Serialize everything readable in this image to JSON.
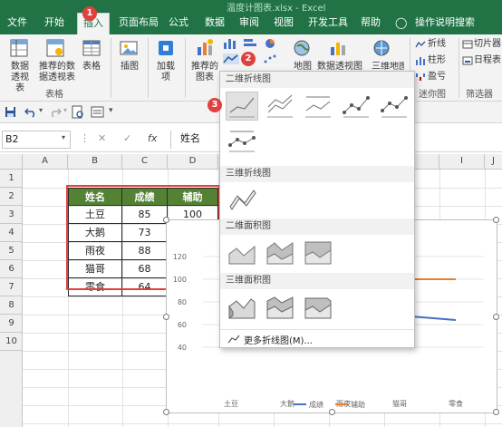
{
  "app": {
    "window_title": "温度计图表.xlsx - Excel",
    "tabs": [
      "文件",
      "开始",
      "插入",
      "页面布局",
      "公式",
      "数据",
      "审阅",
      "视图",
      "开发工具",
      "帮助",
      "操作说明搜索"
    ],
    "active_tab_index": 2
  },
  "ribbon": {
    "pivot_table": "数据透视表",
    "recommended_pivot": "推荐的数据透视表",
    "table": "表格",
    "group_tables": "表格",
    "illustrations": "插图",
    "addins": "加载项",
    "recommended_charts": "推荐的图表",
    "map": "地图",
    "pivot_chart": "数据透视图",
    "three_d_map": "三维地图",
    "sparkline_line": "折线",
    "sparkline_column": "柱形",
    "sparkline_winloss": "盈亏",
    "group_sparklines": "迷你图",
    "slicer": "切片器",
    "timeline": "日程表",
    "group_filters": "筛选器"
  },
  "formula_bar": {
    "name_box": "B2",
    "content": "姓名"
  },
  "grid": {
    "columns": [
      "A",
      "B",
      "C",
      "D",
      "E",
      "F",
      "G",
      "H",
      "I",
      "J"
    ],
    "rows": [
      "1",
      "2",
      "3",
      "4",
      "5",
      "6",
      "7",
      "8",
      "9",
      "10"
    ],
    "table_header": [
      "姓名",
      "成绩",
      "辅助"
    ],
    "names": [
      "土豆",
      "大鹅",
      "雨夜",
      "猫哥",
      "零食"
    ],
    "scores": [
      "85",
      "73",
      "88",
      "68",
      "64"
    ],
    "helper": [
      "100"
    ]
  },
  "chart_data": {
    "type": "line",
    "categories": [
      "土豆",
      "大鹅",
      "雨夜",
      "猫哥",
      "零食"
    ],
    "series": [
      {
        "name": "成绩",
        "values": [
          85,
          73,
          88,
          68,
          64
        ],
        "color": "#4472c4"
      },
      {
        "name": "辅助",
        "values": [
          100,
          100,
          100,
          100,
          100
        ],
        "color": "#ed7d31"
      }
    ],
    "yticks": [
      "120",
      "100",
      "80",
      "60",
      "40"
    ],
    "ylim": [
      0,
      120
    ]
  },
  "dropdown": {
    "section_2d_line": "二维折线图",
    "section_3d_line": "三维折线图",
    "section_2d_area": "二维面积图",
    "section_3d_area": "三维面积图",
    "more": "更多折线图(M)..."
  },
  "badges": [
    "1",
    "2",
    "3"
  ],
  "colors": {
    "excel_green": "#217346",
    "table_header": "#548235",
    "selection_red": "#e0413f",
    "series_score": "#4472c4",
    "series_helper": "#ed7d31"
  }
}
